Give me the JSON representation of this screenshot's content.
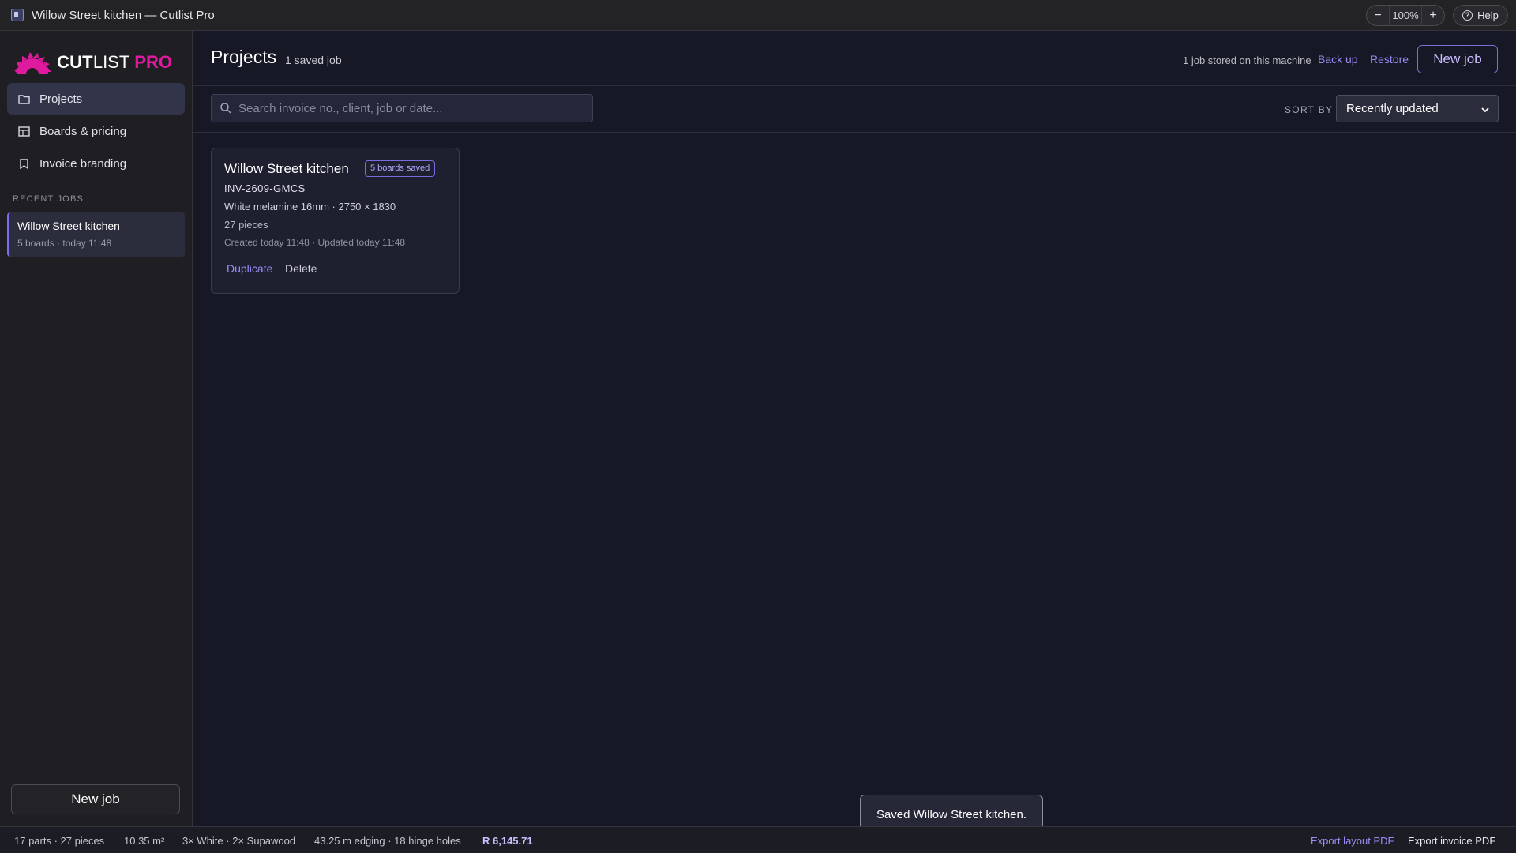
{
  "window": {
    "title": "Willow Street kitchen — Cutlist Pro",
    "zoom": "100%",
    "zoom_out_label": "−",
    "zoom_in_label": "+",
    "help_label": "Help"
  },
  "brand": {
    "word1": "CUT",
    "word2": "LIST",
    "word3": "PRO",
    "accent_color": "#e01a9f"
  },
  "sidebar": {
    "items": [
      {
        "label": "Projects",
        "icon": "folder-icon",
        "active": true
      },
      {
        "label": "Boards & pricing",
        "icon": "table-icon",
        "active": false
      },
      {
        "label": "Invoice branding",
        "icon": "bookmark-icon",
        "active": false
      }
    ],
    "recent_heading": "RECENT JOBS",
    "recent": [
      {
        "name": "Willow Street kitchen",
        "meta": "5 boards · today 11:48"
      }
    ],
    "new_job_label": "New job"
  },
  "header": {
    "title": "Projects",
    "count": "1 saved job",
    "stored_note": "1 job stored on this machine",
    "backup_label": "Back up",
    "restore_label": "Restore",
    "new_job_label": "New job"
  },
  "toolbar": {
    "search_placeholder": "Search invoice no., client, job or date...",
    "search_value": "",
    "sort_label": "SORT BY",
    "sort_value": "Recently updated"
  },
  "projects": [
    {
      "name": "Willow Street kitchen",
      "badge": "5 boards saved",
      "invoice": "INV-2609-GMCS",
      "material": "White melamine 16mm · 2750 × 1830",
      "pieces": "27 pieces",
      "dates": "Created today 11:48 · Updated today 11:48",
      "duplicate_label": "Duplicate",
      "delete_label": "Delete"
    }
  ],
  "toast": "Saved Willow Street kitchen.",
  "status": {
    "parts": "17 parts · 27 pieces",
    "area": "10.35 m²",
    "boards": "3× White · 2× Supawood",
    "edging": "43.25 m edging · 18 hinge holes",
    "total": "R 6,145.71",
    "export_layout": "Export layout PDF",
    "export_invoice": "Export invoice PDF"
  },
  "colors": {
    "accent": "#9a8cf5",
    "background": "#161825",
    "sidebar": "#1f1f23"
  }
}
